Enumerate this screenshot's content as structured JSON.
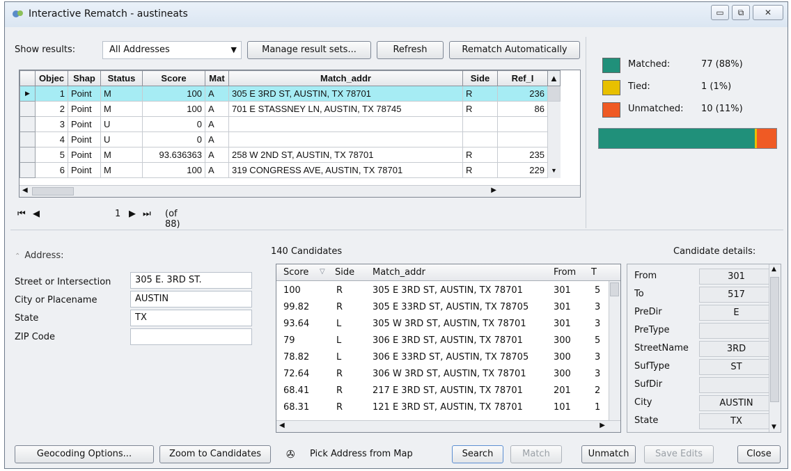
{
  "window": {
    "title": "Interactive Rematch - austineats",
    "controls": [
      "minimize",
      "restore",
      "close"
    ]
  },
  "toolbar": {
    "show_results_label": "Show results:",
    "show_results_value": "All Addresses",
    "manage_label": "Manage result sets...",
    "refresh_label": "Refresh",
    "rematch_auto_label": "Rematch Automatically"
  },
  "results_grid": {
    "columns": [
      "Objec",
      "Shap",
      "Status",
      "Score",
      "Mat",
      "Match_addr",
      "Side",
      "Ref_I"
    ],
    "rows": [
      {
        "id": "1",
        "shape": "Point",
        "status": "M",
        "score": "100",
        "mat": "A",
        "addr": "305 E 3RD ST, AUSTIN, TX 78701",
        "side": "R",
        "ref": "236"
      },
      {
        "id": "2",
        "shape": "Point",
        "status": "M",
        "score": "100",
        "mat": "A",
        "addr": "701 E STASSNEY LN, AUSTIN, TX 78745",
        "side": "R",
        "ref": "86"
      },
      {
        "id": "3",
        "shape": "Point",
        "status": "U",
        "score": "0",
        "mat": "A",
        "addr": "",
        "side": "",
        "ref": ""
      },
      {
        "id": "4",
        "shape": "Point",
        "status": "U",
        "score": "0",
        "mat": "A",
        "addr": "",
        "side": "",
        "ref": ""
      },
      {
        "id": "5",
        "shape": "Point",
        "status": "M",
        "score": "93.636363",
        "mat": "A",
        "addr": "258 W 2ND ST, AUSTIN, TX 78701",
        "side": "R",
        "ref": "235"
      },
      {
        "id": "6",
        "shape": "Point",
        "status": "M",
        "score": "100",
        "mat": "A",
        "addr": "319 CONGRESS AVE, AUSTIN, TX 78701",
        "side": "R",
        "ref": "229"
      }
    ],
    "selected_index": 0
  },
  "navigator": {
    "current": "1",
    "total_label": "(of 88)"
  },
  "summary": {
    "matched_label": "Matched:",
    "matched_value": "77 (88%)",
    "matched_color": "#20907a",
    "matched_fraction": 0.88,
    "tied_label": "Tied:",
    "tied_value": "1 (1%)",
    "tied_color": "#e8c000",
    "tied_fraction": 0.01,
    "unmatched_label": "Unmatched:",
    "unmatched_value": "10 (11%)",
    "unmatched_color": "#ef5a24",
    "unmatched_fraction": 0.11
  },
  "address": {
    "header": "Address:",
    "fields": [
      {
        "label": "Street or Intersection",
        "value": "305 E. 3RD ST."
      },
      {
        "label": "City or Placename",
        "value": "AUSTIN"
      },
      {
        "label": "State",
        "value": "TX"
      },
      {
        "label": "ZIP Code",
        "value": ""
      }
    ]
  },
  "candidates": {
    "count_label": "140 Candidates",
    "columns": [
      "Score",
      "Side",
      "Match_addr",
      "From",
      "T"
    ],
    "rows": [
      {
        "score": "100",
        "side": "R",
        "addr": "305 E 3RD ST, AUSTIN, TX 78701",
        "from": "301",
        "to": "5"
      },
      {
        "score": "99.82",
        "side": "R",
        "addr": "305 E 33RD ST, AUSTIN, TX 78705",
        "from": "301",
        "to": "3"
      },
      {
        "score": "93.64",
        "side": "L",
        "addr": "305 W 3RD ST, AUSTIN, TX 78701",
        "from": "301",
        "to": "3"
      },
      {
        "score": "79",
        "side": "L",
        "addr": "306 E 3RD ST, AUSTIN, TX 78701",
        "from": "300",
        "to": "5"
      },
      {
        "score": "78.82",
        "side": "L",
        "addr": "306 E 33RD ST, AUSTIN, TX 78705",
        "from": "300",
        "to": "3"
      },
      {
        "score": "72.64",
        "side": "R",
        "addr": "306 W 3RD ST, AUSTIN, TX 78701",
        "from": "300",
        "to": "3"
      },
      {
        "score": "68.41",
        "side": "R",
        "addr": "217 E 3RD ST, AUSTIN, TX 78701",
        "from": "201",
        "to": "2"
      },
      {
        "score": "68.31",
        "side": "R",
        "addr": "121 E 3RD ST, AUSTIN, TX 78701",
        "from": "101",
        "to": "1"
      }
    ]
  },
  "details": {
    "header": "Candidate details:",
    "fields": [
      {
        "key": "From",
        "value": "301"
      },
      {
        "key": "To",
        "value": "517"
      },
      {
        "key": "PreDir",
        "value": "E"
      },
      {
        "key": "PreType",
        "value": ""
      },
      {
        "key": "StreetName",
        "value": "3RD"
      },
      {
        "key": "SufType",
        "value": "ST"
      },
      {
        "key": "SufDir",
        "value": ""
      },
      {
        "key": "City",
        "value": "AUSTIN"
      },
      {
        "key": "State",
        "value": "TX"
      }
    ]
  },
  "footer": {
    "geocoding_options": "Geocoding Options...",
    "zoom_to_candidates": "Zoom to Candidates",
    "pick_address": "Pick Address from Map",
    "search": "Search",
    "match": "Match",
    "unmatch": "Unmatch",
    "save_edits": "Save Edits",
    "close": "Close"
  }
}
